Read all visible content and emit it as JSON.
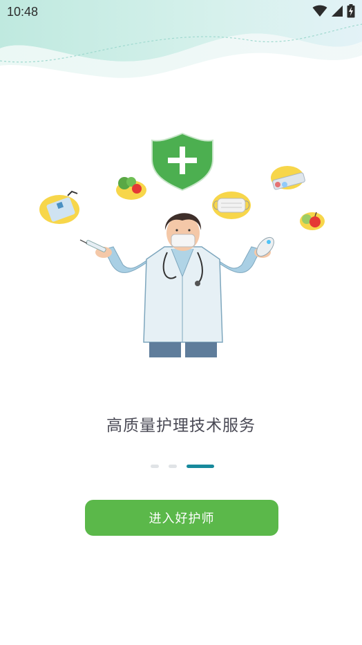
{
  "status_bar": {
    "time": "10:48",
    "icons": [
      "wifi-icon",
      "cellular-signal-icon",
      "battery-charging-icon"
    ]
  },
  "illustration": {
    "subject": "doctor-with-shield-illustration",
    "icons": [
      "shield-plus-icon",
      "hand-sanitizer-icon",
      "vegetables-icon",
      "face-mask-icon",
      "pills-icon",
      "apple-icon",
      "syringe-icon",
      "thermometer-icon"
    ]
  },
  "onboarding": {
    "slogan": "高质量护理技术服务",
    "page_count": 3,
    "active_page": 3
  },
  "enter_button": {
    "label": "进入好护师"
  },
  "colors": {
    "accent_green": "#5bb84a",
    "active_dot": "#17899c",
    "inactive_dot": "#e0e3e6",
    "shield_green": "#4caf50",
    "wave_teal": "#c8ece4"
  }
}
